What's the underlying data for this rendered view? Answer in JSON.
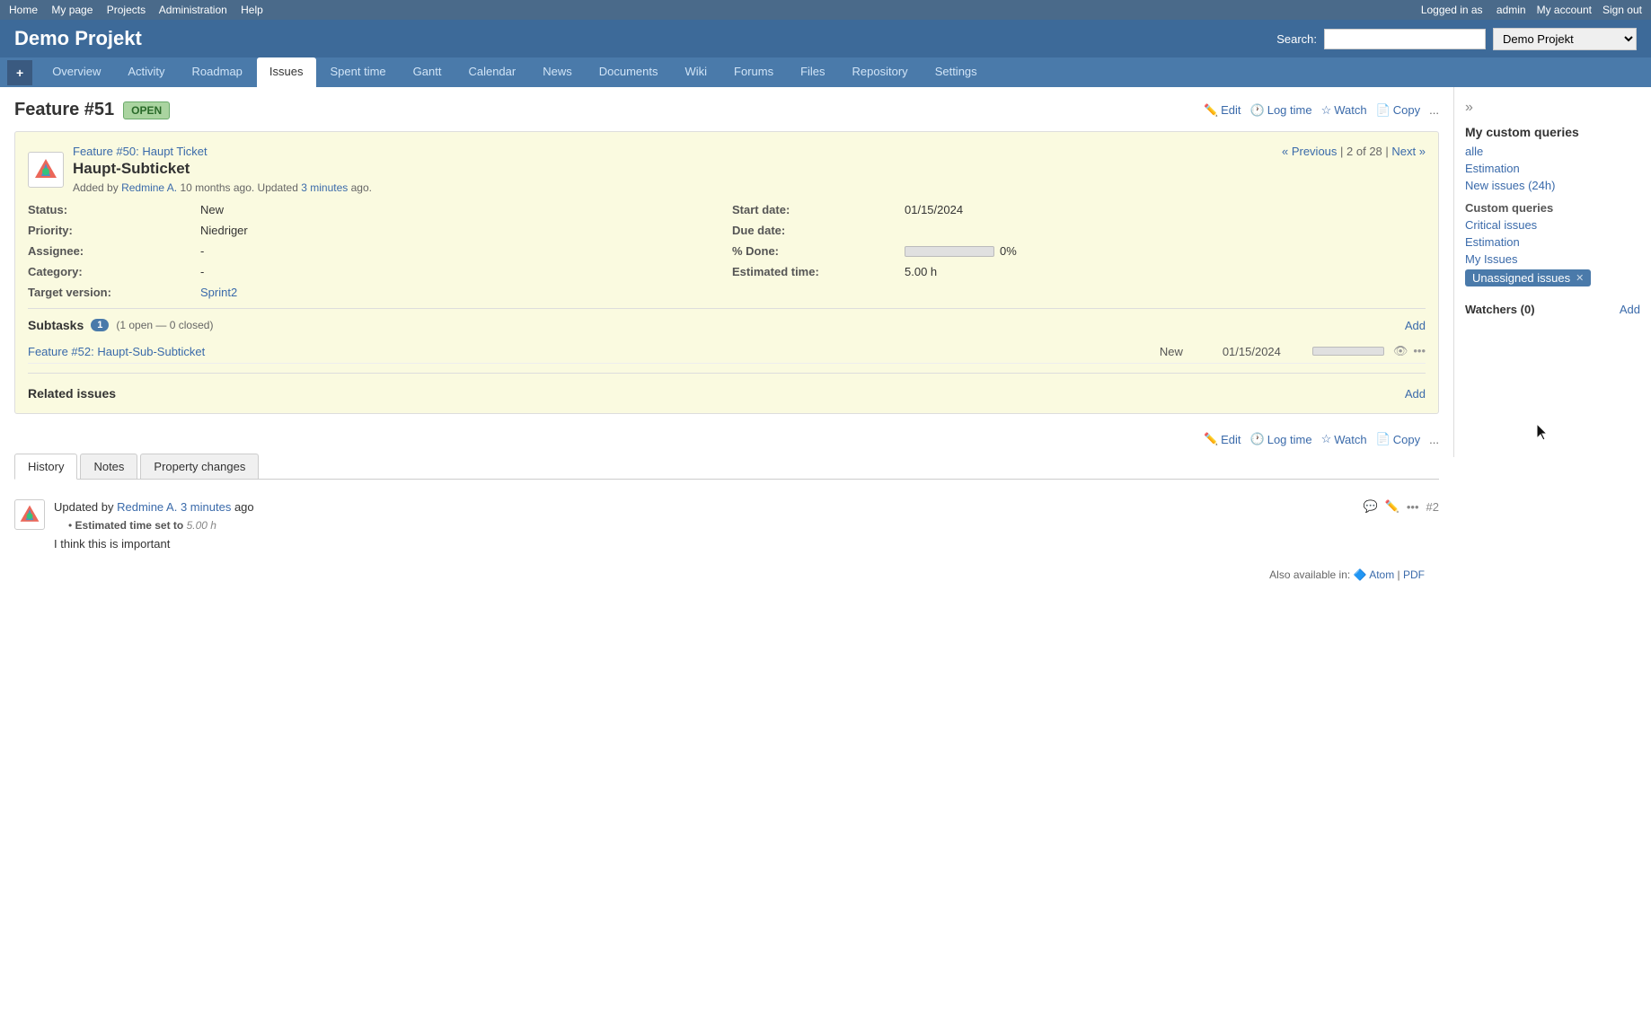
{
  "topbar": {
    "left_links": [
      "Home",
      "My page",
      "Projects",
      "Administration",
      "Help"
    ],
    "right_text": "Logged in as",
    "username": "admin",
    "my_account": "My account",
    "sign_out": "Sign out"
  },
  "header": {
    "title": "Demo Projekt",
    "search_label": "Search:",
    "search_placeholder": "",
    "project_select": "Demo Projekt"
  },
  "nav": {
    "plus_label": "+",
    "tabs": [
      "Overview",
      "Activity",
      "Roadmap",
      "Issues",
      "Spent time",
      "Gantt",
      "Calendar",
      "News",
      "Documents",
      "Wiki",
      "Forums",
      "Files",
      "Repository",
      "Settings"
    ],
    "active_tab": "Issues"
  },
  "issue": {
    "title": "Feature #51",
    "badge": "OPEN",
    "actions": {
      "edit": "Edit",
      "log_time": "Log time",
      "watch": "Watch",
      "copy": "Copy",
      "more": "..."
    },
    "parent_label": "Feature #50:",
    "parent_name": "Haupt Ticket",
    "issue_name": "Haupt-Subticket",
    "added_by": "Added by",
    "author": "Redmine A.",
    "added_time": "10 months",
    "updated_label": "Updated",
    "updated_time": "3 minutes",
    "pagination": {
      "prev": "« Previous",
      "current": "2 of 28",
      "next": "Next »"
    },
    "props": {
      "status_label": "Status:",
      "status_value": "New",
      "start_date_label": "Start date:",
      "start_date_value": "01/15/2024",
      "priority_label": "Priority:",
      "priority_value": "Niedriger",
      "due_date_label": "Due date:",
      "due_date_value": "",
      "assignee_label": "Assignee:",
      "assignee_value": "-",
      "done_label": "% Done:",
      "done_value": "0%",
      "category_label": "Category:",
      "category_value": "-",
      "est_time_label": "Estimated time:",
      "est_time_value": "5.00 h",
      "target_label": "Target version:",
      "target_value": "Sprint2"
    },
    "subtasks": {
      "title": "Subtasks",
      "count": "1",
      "detail": "(1 open — 0 closed)",
      "add": "Add",
      "items": [
        {
          "link": "Feature #52: Haupt-Sub-Subticket",
          "status": "New",
          "date": "01/15/2024"
        }
      ]
    },
    "related_issues": {
      "title": "Related issues",
      "add": "Add"
    }
  },
  "tabs": {
    "history": "History",
    "notes": "Notes",
    "property_changes": "Property changes",
    "active": "History"
  },
  "history_entry": {
    "updated_label": "Updated by",
    "author": "Redmine A.",
    "time": "3 minutes",
    "time_suffix": "ago",
    "entry_number": "#2",
    "change": {
      "field": "Estimated time",
      "action": "set to",
      "value": "5.00 h"
    },
    "note": "I think this is important"
  },
  "footer": {
    "label": "Also available in:",
    "atom": "Atom",
    "pdf": "PDF"
  },
  "sidebar": {
    "expand_icon": "»",
    "my_queries_title": "My custom queries",
    "my_queries": [
      "alle",
      "Estimation",
      "New issues (24h)"
    ],
    "custom_queries_title": "Custom queries",
    "custom_queries": [
      "Critical issues",
      "Estimation",
      "My Issues"
    ],
    "active_query": "Unassigned issues",
    "watchers_title": "Watchers (0)",
    "watchers_add": "Add"
  }
}
